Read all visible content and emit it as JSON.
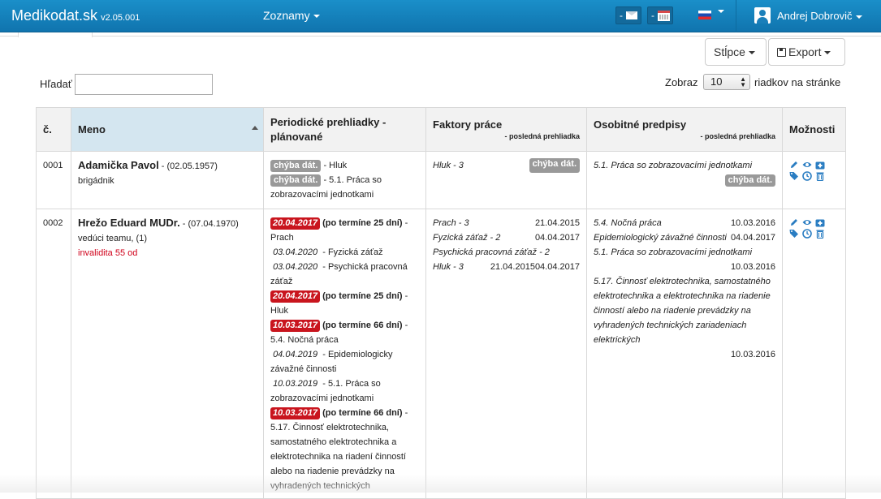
{
  "app": {
    "brand": "Medikodat.sk",
    "version": "v2.05.001",
    "menu_lists": "Zoznamy",
    "user_name": "Andrej Dobrovič",
    "mail_dash": "-",
    "calendar_dash": "-"
  },
  "toolbar": {
    "columns_label": "Stĺpce",
    "export_label": "Export"
  },
  "search": {
    "label": "Hľadať",
    "value": ""
  },
  "paging": {
    "show_label": "Zobraz",
    "page_size": "10",
    "rows_label": "riadkov na stránke"
  },
  "table": {
    "headers": {
      "num": "č.",
      "name": "Meno",
      "periodic": "Periodické prehliadky - plánované",
      "factors": "Faktory práce",
      "factors_sub": "- posledná prehliadka",
      "special": "Osobitné predpisy",
      "special_sub": "- posledná prehliadka",
      "options": "Možnosti"
    },
    "rows": [
      {
        "num": "0001",
        "name": "Adamička Pavol",
        "birth": " - (02.05.1957)",
        "role": "brigádnik",
        "invalid": "",
        "periodic": [
          {
            "badge": "chýba dát.",
            "text": " - Hluk"
          },
          {
            "badge": "chýba dát.",
            "text": " - 5.1. Práca so zobrazovacími jednotkami"
          }
        ],
        "factors": [
          {
            "name": "Hluk - 3",
            "badge": "chýba dát."
          }
        ],
        "special": [
          {
            "name": "5.1. Práca so zobrazovacími jednotkami",
            "badge": "chýba dát."
          }
        ]
      },
      {
        "num": "0002",
        "name": "Hrežo Eduard MUDr.",
        "birth": " - (07.04.1970)",
        "role": "vedúci teamu, (1)",
        "invalid": "invalidita 55 od",
        "periodic": [
          {
            "date": "20.04.2017",
            "overdue": "(po termíne 25 dní)",
            "text": " - Prach"
          },
          {
            "plain_date": "03.04.2020",
            "text": " - Fyzická záťaž"
          },
          {
            "plain_date": "03.04.2020",
            "text": " - Psychická pracovná záťaž"
          },
          {
            "date": "20.04.2017",
            "overdue": "(po termíne 25 dní)",
            "text": " - Hluk"
          },
          {
            "date": "10.03.2017",
            "overdue": "(po termíne 66 dní)",
            "text": " - 5.4. Nočná práca"
          },
          {
            "plain_date": "04.04.2019",
            "text": " - Epidemiologicky závažné činnosti"
          },
          {
            "plain_date": "10.03.2019",
            "text": " - 5.1. Práca so zobrazovacími jednotkami"
          },
          {
            "date": "10.03.2017",
            "overdue": "(po termíne 66 dní)",
            "text": " - 5.17. Činnosť elektrotechnika, samostatného elektrotechnika a elektrotechnika na riadení činností alebo na riadenie prevádzky na vyhradených technických"
          }
        ],
        "factors": [
          {
            "name": "Prach - 3",
            "date": "21.04.2015"
          },
          {
            "name": "Fyzická záťaž - 2",
            "date": "04.04.2017"
          },
          {
            "name": "Psychická pracovná záťaž - 2",
            "date": ""
          },
          {
            "name": "Hluk - 3",
            "date": "21.04.201504.04.2017"
          }
        ],
        "special": [
          {
            "name": "5.4. Nočná práca",
            "date": "10.03.2016"
          },
          {
            "name": "Epidemiologický závažné činnosti",
            "date": "04.04.2017"
          },
          {
            "name": "5.1. Práca so zobrazovacími jednotkami",
            "date": "10.03.2016"
          },
          {
            "name": "5.17. Činnosť elektrotechnika, samostatného elektrotechnika a elektrotechnika na riadenie činností alebo na riadenie prevádzky na vyhradených technických zariadeniach elektrických",
            "date": "10.03.2016"
          }
        ]
      }
    ]
  },
  "colors": {
    "navbar": "#1582bf",
    "badge_grey": "#999999",
    "badge_red": "#c9151e",
    "icon_blue": "#2a7dc2"
  }
}
